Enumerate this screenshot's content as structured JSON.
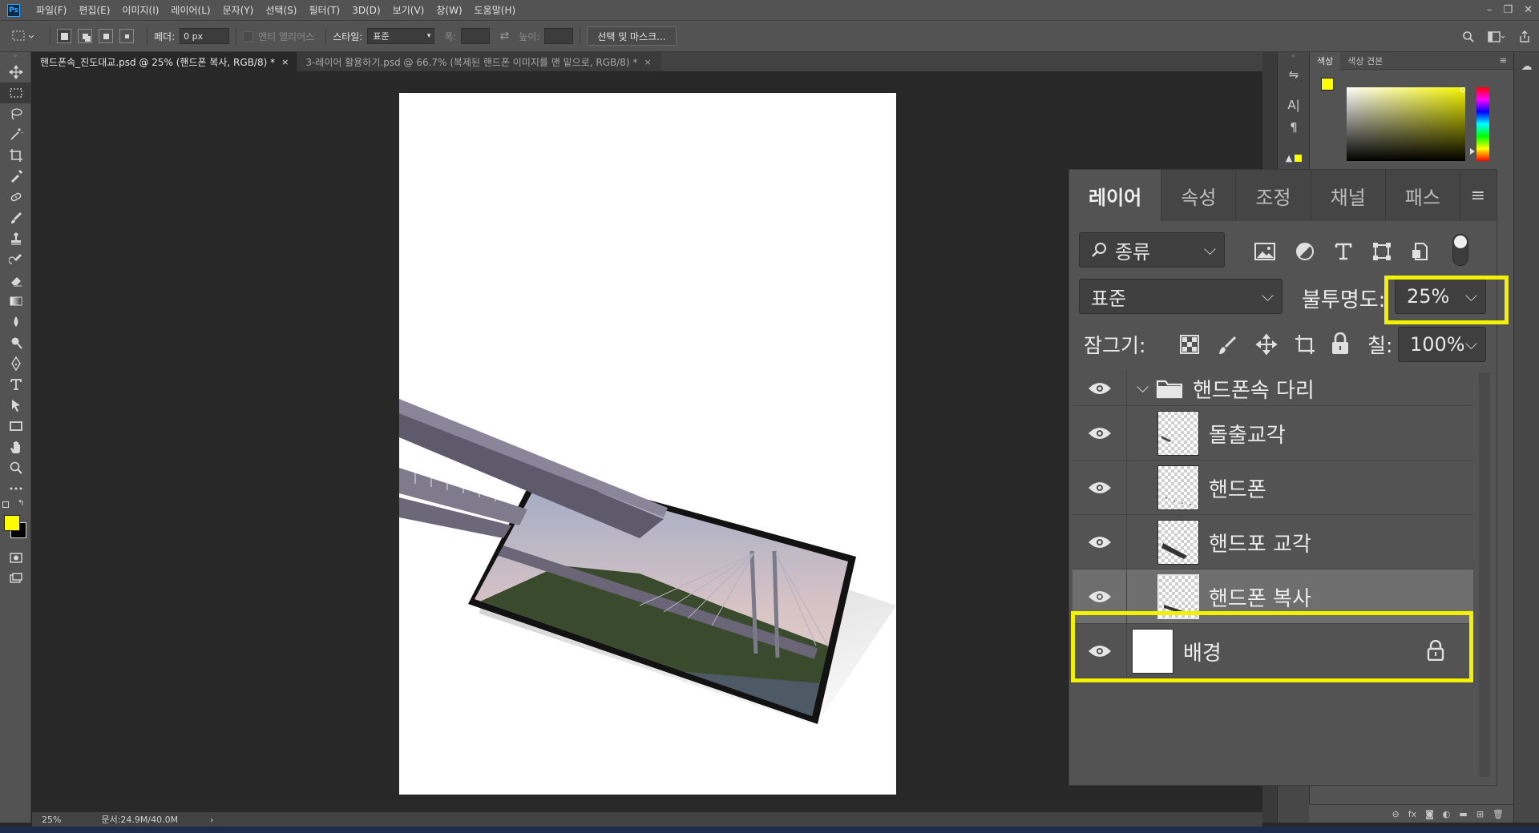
{
  "app": {
    "logo": "Ps",
    "menu": [
      "파일(F)",
      "편집(E)",
      "이미지(I)",
      "레이어(L)",
      "문자(Y)",
      "선택(S)",
      "필터(T)",
      "3D(D)",
      "보기(V)",
      "창(W)",
      "도움말(H)"
    ],
    "window_controls": [
      "–",
      "❐",
      "✕"
    ]
  },
  "options": {
    "feather_label": "페더:",
    "feather_value": "0 px",
    "antialias_label": "앤티 앨리어스",
    "style_label": "스타일:",
    "style_value": "표준",
    "width_label": "폭:",
    "height_label": "높이:",
    "select_mask_button": "선택 및 마스크..."
  },
  "documents": [
    {
      "title": "핸드폰속_진도대교.psd @ 25% (핸드폰 복사, RGB/8) *",
      "close": "×"
    },
    {
      "title": "3-레이어 활용하기.psd @ 66.7% (복제된 핸드폰 이미지를 맨 밑으로, RGB/8) *",
      "close": "×"
    }
  ],
  "status": {
    "zoom": "25%",
    "doc_size": "문서:24.9M/40.0M",
    "arrow": "›"
  },
  "color_panel": {
    "tabs": [
      "색상",
      "색상 견본"
    ],
    "foreground": "#ffff00",
    "background": "#000000",
    "gradient_end": "#d8d83a"
  },
  "layers_panel": {
    "tabs": [
      "레이어",
      "속성",
      "조정",
      "채널",
      "패스"
    ],
    "menu_icon": "≡",
    "filter_value": "종류",
    "blend_mode": "표준",
    "opacity_label": "불투명도:",
    "opacity_value": "25%",
    "lock_label": "잠그기:",
    "fill_label": "칠:",
    "fill_value": "100%",
    "highlight_color": "#f2f200",
    "group": {
      "name": "핸드폰속 다리",
      "expanded": true
    },
    "layers": [
      {
        "name": "돌출교각",
        "selected": false
      },
      {
        "name": "핸드폰",
        "selected": false
      },
      {
        "name": "핸드포 교각",
        "selected": false
      },
      {
        "name": "핸드폰 복사",
        "selected": true
      }
    ],
    "background_layer": {
      "name": "배경",
      "locked": true
    },
    "footer_icons": [
      "link-icon",
      "fx-icon",
      "mask-icon",
      "adjustment-icon",
      "folder-icon",
      "new-layer-icon",
      "trash-icon"
    ],
    "footer_labels": [
      "⊖",
      "fx"
    ]
  }
}
